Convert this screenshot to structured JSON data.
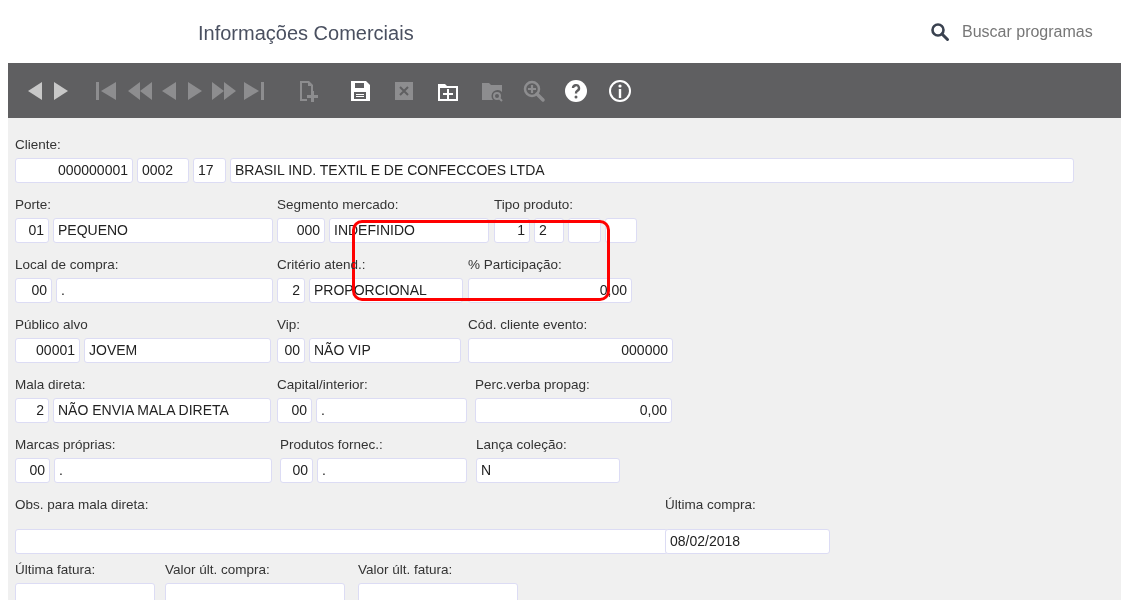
{
  "header": {
    "title": "Informações Comerciais",
    "search_placeholder": "Buscar programas"
  },
  "toolbar": [
    {
      "kind": "back",
      "disabled": false
    },
    {
      "kind": "forward",
      "disabled": false
    },
    {
      "kind": "first",
      "disabled": true
    },
    {
      "kind": "rewind",
      "disabled": true
    },
    {
      "kind": "prev",
      "disabled": true
    },
    {
      "kind": "next",
      "disabled": true
    },
    {
      "kind": "fastforward",
      "disabled": true
    },
    {
      "kind": "last",
      "disabled": true
    },
    {
      "kind": "new",
      "disabled": true
    },
    {
      "kind": "save",
      "disabled": false
    },
    {
      "kind": "cancel",
      "disabled": true
    },
    {
      "kind": "add",
      "disabled": false
    },
    {
      "kind": "find",
      "disabled": true
    },
    {
      "kind": "zoom",
      "disabled": true
    },
    {
      "kind": "help",
      "disabled": false
    },
    {
      "kind": "info",
      "disabled": false
    }
  ],
  "form": [
    [
      {
        "label": "Cliente:",
        "boxes": [
          {
            "kind": "filled",
            "value": "000000001"
          },
          {
            "kind": "filled",
            "value": "0002"
          },
          {
            "kind": "filled",
            "value": "17"
          },
          {
            "kind": "filled",
            "value": "BRASIL IND. TEXTIL E DE CONFECCOES LTDA"
          }
        ]
      }
    ],
    [
      {
        "label": "Porte:",
        "boxes": [
          {
            "kind": "filled",
            "value": "01"
          },
          {
            "kind": "filled",
            "value": "PEQUENO"
          }
        ]
      },
      {
        "label": "Segmento mercado:",
        "boxes": [
          {
            "kind": "filled",
            "value": "000"
          },
          {
            "kind": "filled",
            "value": "INDEFINIDO"
          }
        ]
      },
      {
        "label": "Tipo produto:",
        "boxes": [
          {
            "kind": "filled",
            "value": "1"
          },
          {
            "kind": "filled",
            "value": "2"
          },
          {
            "kind": "blank"
          },
          {
            "kind": "blank"
          }
        ]
      }
    ],
    [
      {
        "label": "Local de compra:",
        "boxes": [
          {
            "kind": "filled",
            "value": "00"
          },
          {
            "kind": "filled",
            "value": "."
          }
        ]
      },
      {
        "label": "Critério atend.:",
        "boxes": [
          {
            "kind": "filled",
            "value": "2"
          },
          {
            "kind": "filled",
            "value": "PROPORCIONAL"
          }
        ]
      },
      {
        "label": "% Participação:",
        "boxes": [
          {
            "kind": "filled",
            "value": "0,00"
          }
        ]
      }
    ],
    [
      {
        "label": "Público alvo",
        "boxes": [
          {
            "kind": "filled",
            "value": "00001"
          },
          {
            "kind": "filled",
            "value": "JOVEM"
          }
        ]
      },
      {
        "label": "Vip:",
        "boxes": [
          {
            "kind": "filled",
            "value": "00"
          },
          {
            "kind": "filled",
            "value": "NÃO VIP"
          }
        ]
      },
      {
        "label": "Cód. cliente evento:",
        "boxes": [
          {
            "kind": "filled",
            "value": "000000"
          }
        ]
      }
    ],
    [
      {
        "label": "Mala direta:",
        "boxes": [
          {
            "kind": "filled",
            "value": "2"
          },
          {
            "kind": "filled",
            "value": "NÃO ENVIA MALA DIRETA"
          }
        ]
      },
      {
        "label": "Capital/interior:",
        "boxes": [
          {
            "kind": "filled",
            "value": "00"
          },
          {
            "kind": "filled",
            "value": "."
          }
        ]
      },
      {
        "label": "Perc.verba propag:",
        "boxes": [
          {
            "kind": "filled",
            "value": "0,00"
          }
        ]
      }
    ],
    [
      {
        "label": "Marcas próprias:",
        "boxes": [
          {
            "kind": "filled",
            "value": "00"
          },
          {
            "kind": "filled",
            "value": "."
          }
        ]
      },
      {
        "label": "Produtos fornec.:",
        "boxes": [
          {
            "kind": "filled",
            "value": "00"
          },
          {
            "kind": "filled",
            "value": "."
          }
        ]
      },
      {
        "label": "Lança coleção:",
        "boxes": [
          {
            "kind": "filled",
            "value": "N"
          }
        ]
      }
    ],
    [
      {
        "label": "Obs. para mala direta:",
        "boxes": [
          {
            "kind": "blank"
          }
        ]
      },
      {
        "label": "Última compra:",
        "boxes": [
          {
            "kind": "filled",
            "value": "08/02/2018"
          }
        ]
      }
    ],
    [
      {
        "label": "Última fatura:",
        "boxes": [
          {
            "kind": "blank"
          }
        ]
      },
      {
        "label": "Valor últ. compra:",
        "boxes": [
          {
            "kind": "blank"
          }
        ]
      },
      {
        "label": "Valor últ. fatura:",
        "boxes": [
          {
            "kind": "blank"
          }
        ]
      }
    ]
  ]
}
